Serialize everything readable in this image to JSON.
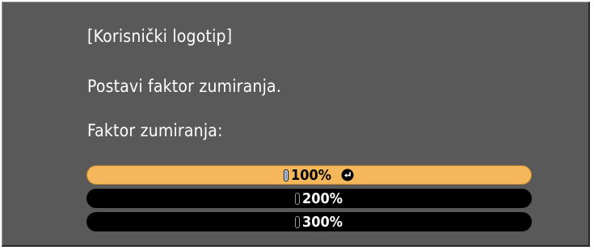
{
  "dialog": {
    "title": "[Korisnički logotip]",
    "instruction": "Postavi faktor zumiranja.",
    "zoom_label": "Faktor zumiranja:"
  },
  "options": [
    {
      "label": "100%",
      "selected": true,
      "checked": true,
      "icon": "enter-icon"
    },
    {
      "label": "200%",
      "selected": false,
      "checked": false
    },
    {
      "label": "300%",
      "selected": false,
      "checked": false
    }
  ],
  "colors": {
    "background": "#595959",
    "highlight": "#f4b75b",
    "option_bg": "#000000",
    "text": "#ffffff"
  }
}
